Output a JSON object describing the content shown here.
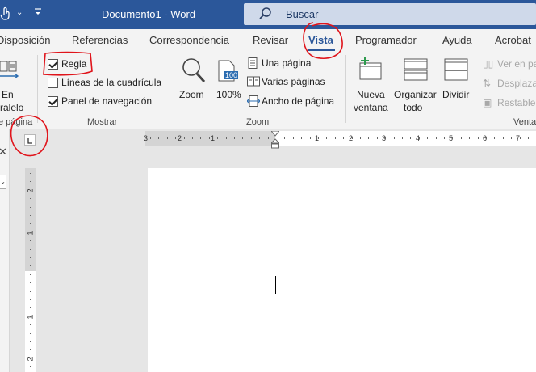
{
  "titlebar": {
    "document_title": "Documento1  -  Word",
    "search_text": "Buscar"
  },
  "tabs": [
    {
      "label": "Disposición"
    },
    {
      "label": "Referencias"
    },
    {
      "label": "Correspondencia"
    },
    {
      "label": "Revisar"
    },
    {
      "label": "Vista"
    },
    {
      "label": "Programador"
    },
    {
      "label": "Ayuda"
    },
    {
      "label": "Acrobat"
    }
  ],
  "ribbon": {
    "vistas": {
      "parallel_line1": "En",
      "parallel_line2": "ralelo",
      "group_label": "e página"
    },
    "mostrar": {
      "regla": "Regla",
      "lineas": "Líneas de la cuadrícula",
      "panel": "Panel de navegación",
      "group_label": "Mostrar",
      "regla_checked": true,
      "lineas_checked": false,
      "panel_checked": true
    },
    "zoom": {
      "zoom_label": "Zoom",
      "pct_label": "100%",
      "pct_badge": "100",
      "una_pagina": "Una página",
      "varias_paginas": "Varias páginas",
      "ancho": "Ancho de página",
      "group_label": "Zoom"
    },
    "ventana": {
      "nueva_line1": "Nueva",
      "nueva_line2": "ventana",
      "organizar_line1": "Organizar",
      "organizar_line2": "todo",
      "dividir": "Dividir",
      "ver_en_pa": "Ver en pa",
      "desplaza": "Desplaza",
      "restable": "Restable",
      "group_label": "Venta"
    }
  },
  "ruler": {
    "h_numbers": [
      "3",
      "2",
      "1",
      "1",
      "2",
      "3",
      "4",
      "5",
      "6",
      "7"
    ],
    "v_numbers": [
      "2",
      "1",
      "1",
      "2"
    ]
  },
  "colors": {
    "titlebar": "#2b579a",
    "annotation": "#e0141b"
  }
}
